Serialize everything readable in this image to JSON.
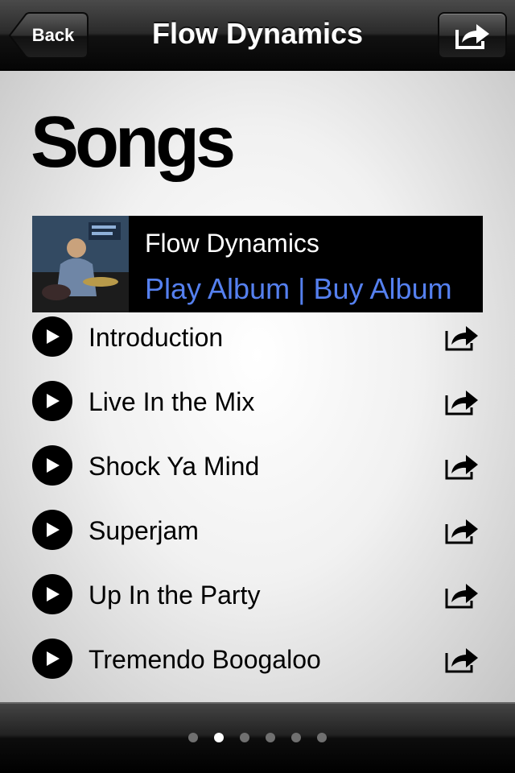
{
  "navbar": {
    "back_label": "Back",
    "title": "Flow Dynamics"
  },
  "main": {
    "title": "Songs",
    "album": {
      "name": "Flow Dynamics",
      "play_label": "Play Album",
      "separator": "|",
      "buy_label": "Buy Album"
    },
    "songs": [
      {
        "title": "Introduction"
      },
      {
        "title": "Live In the Mix"
      },
      {
        "title": "Shock Ya Mind"
      },
      {
        "title": "Superjam"
      },
      {
        "title": "Up In the Party"
      },
      {
        "title": "Tremendo Boogaloo"
      }
    ]
  },
  "page_indicator": {
    "total": 6,
    "current": 2
  },
  "colors": {
    "link": "#5580ef",
    "navbar": "#1a1a1a"
  },
  "icons": {
    "share": "share-arrow-icon",
    "play": "play-icon"
  }
}
